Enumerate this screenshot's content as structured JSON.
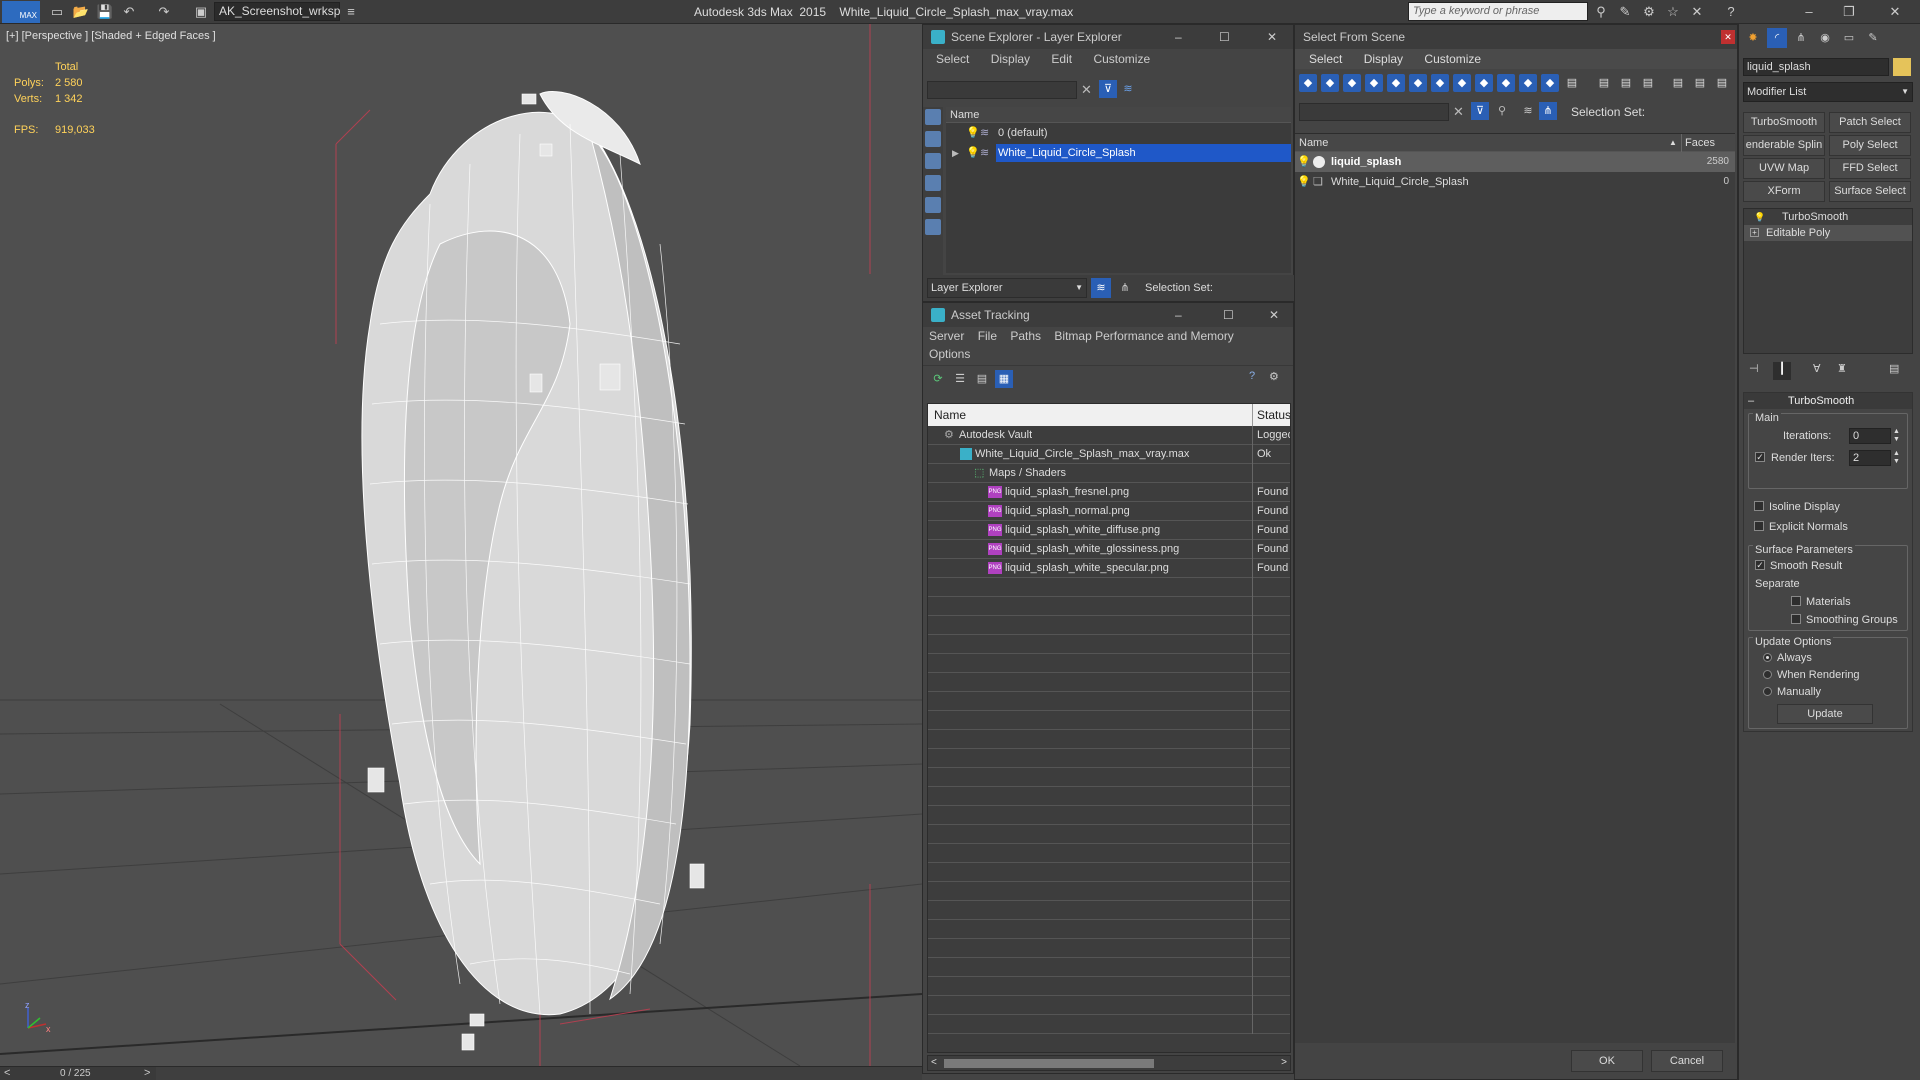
{
  "titlebar": {
    "workspace": "AK_Screenshot_wrksp",
    "app_title": "Autodesk 3ds Max  2015    White_Liquid_Circle_Splash_max_vray.max",
    "search_placeholder": "Type a keyword or phrase",
    "logo": "MAX"
  },
  "viewport": {
    "label": "[+] [Perspective ] [Shaded + Edged Faces ]",
    "stats_total": "Total",
    "polys_label": "Polys:",
    "polys_value": "2 580",
    "verts_label": "Verts:",
    "verts_value": "1 342",
    "fps_label": "FPS:",
    "fps_value": "919,033",
    "timeline": "0 / 225",
    "axis_z": "z",
    "axis_x": "x"
  },
  "scene_explorer": {
    "title": "Scene Explorer - Layer Explorer",
    "menu": [
      "Select",
      "Display",
      "Edit",
      "Customize"
    ],
    "col_name": "Name",
    "rows": [
      "0 (default)",
      "White_Liquid_Circle_Splash"
    ],
    "footer_dropdown": "Layer Explorer",
    "selection_set": "Selection Set:"
  },
  "asset_tracking": {
    "title": "Asset Tracking",
    "menu": [
      "Server",
      "File",
      "Paths",
      "Bitmap Performance and Memory"
    ],
    "menu2": "Options",
    "col_name": "Name",
    "col_status": "Status",
    "rows": [
      {
        "name": "Autodesk Vault",
        "status": "Logged"
      },
      {
        "name": "White_Liquid_Circle_Splash_max_vray.max",
        "status": "Ok"
      },
      {
        "name": "Maps / Shaders",
        "status": ""
      },
      {
        "name": "liquid_splash_fresnel.png",
        "status": "Found"
      },
      {
        "name": "liquid_splash_normal.png",
        "status": "Found"
      },
      {
        "name": "liquid_splash_white_diffuse.png",
        "status": "Found"
      },
      {
        "name": "liquid_splash_white_glossiness.png",
        "status": "Found"
      },
      {
        "name": "liquid_splash_white_specular.png",
        "status": "Found"
      }
    ],
    "png_tag": "PNG"
  },
  "select_scene": {
    "title": "Select From Scene",
    "menu": [
      "Select",
      "Display",
      "Customize"
    ],
    "selection_set": "Selection Set:",
    "col_name": "Name",
    "col_faces": "Faces",
    "rows": [
      {
        "name": "liquid_splash",
        "faces": "2580"
      },
      {
        "name": "White_Liquid_Circle_Splash",
        "faces": "0"
      }
    ],
    "ok": "OK",
    "cancel": "Cancel"
  },
  "modify": {
    "object_name": "liquid_splash",
    "modifier_list": "Modifier List",
    "buttons": [
      "TurboSmooth",
      "Patch Select",
      "enderable Splin",
      "Poly Select",
      "UVW Map",
      "FFD Select",
      "XForm",
      "Surface Select"
    ],
    "stack": [
      "TurboSmooth",
      "Editable Poly"
    ],
    "rollout_title": "TurboSmooth",
    "main": "Main",
    "iterations_label": "Iterations:",
    "iterations_value": "0",
    "render_iters_label": "Render Iters:",
    "render_iters_value": "2",
    "isoline": "Isoline Display",
    "explicit": "Explicit Normals",
    "surface_params": "Surface Parameters",
    "smooth_result": "Smooth Result",
    "separate": "Separate",
    "materials": "Materials",
    "smoothing_groups": "Smoothing Groups",
    "update_options": "Update Options",
    "always": "Always",
    "when_rendering": "When Rendering",
    "manually": "Manually",
    "update_btn": "Update"
  },
  "colors": {
    "accent": "#2a5fb5",
    "selected_row": "#1f58c8",
    "viewport_bg": "#4f4f4f"
  }
}
